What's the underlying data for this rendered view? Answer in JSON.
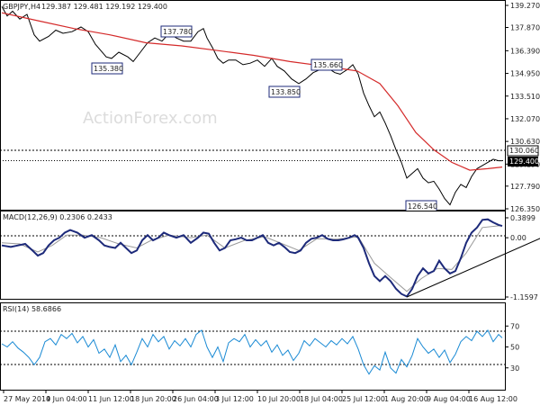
{
  "header": {
    "symbol": "GBPJPY,H4",
    "quote": "129.387 129.481 129.192 129.400"
  },
  "watermark": "ActionForex.com",
  "chart_data": [
    {
      "type": "line",
      "title": "GBPJPY,H4",
      "description": "GBPJPY H4 candlesticks with a moving average",
      "ylim": [
        126.35,
        139.27
      ],
      "yticks": [
        "139.270",
        "137.870",
        "136.390",
        "134.950",
        "133.510",
        "132.070",
        "130.630",
        "129.190",
        "127.790",
        "126.350"
      ],
      "x_labels": [
        "27 May 2019",
        "4 Jun 04:00",
        "11 Jun 12:00",
        "18 Jun 20:00",
        "26 Jun 04:00",
        "3 Jul 12:00",
        "10 Jul 20:00",
        "18 Jul 04:00",
        "25 Jul 12:00",
        "1 Aug 20:00",
        "9 Aug 04:00",
        "16 Aug 12:00"
      ],
      "current_price": "129.400",
      "resistance_level": "130.060",
      "annotations": [
        "137.780",
        "135.380",
        "135.660",
        "133.850",
        "126.540"
      ],
      "price_path": [
        [
          0,
          139.2
        ],
        [
          6,
          138.6
        ],
        [
          12,
          138.9
        ],
        [
          20,
          138.4
        ],
        [
          28,
          138.7
        ],
        [
          36,
          137.4
        ],
        [
          42,
          137.0
        ],
        [
          52,
          137.3
        ],
        [
          60,
          137.7
        ],
        [
          68,
          137.5
        ],
        [
          78,
          137.6
        ],
        [
          88,
          137.9
        ],
        [
          96,
          137.6
        ],
        [
          104,
          136.8
        ],
        [
          110,
          136.4
        ],
        [
          116,
          136.0
        ],
        [
          122,
          135.9
        ],
        [
          130,
          136.3
        ],
        [
          140,
          136.0
        ],
        [
          146,
          135.7
        ],
        [
          154,
          136.3
        ],
        [
          162,
          136.9
        ],
        [
          170,
          137.2
        ],
        [
          178,
          137.0
        ],
        [
          186,
          137.5
        ],
        [
          194,
          137.2
        ],
        [
          202,
          137.0
        ],
        [
          210,
          137.0
        ],
        [
          218,
          137.6
        ],
        [
          224,
          137.8
        ],
        [
          228,
          137.2
        ],
        [
          234,
          136.6
        ],
        [
          240,
          135.9
        ],
        [
          246,
          135.6
        ],
        [
          252,
          135.8
        ],
        [
          260,
          135.8
        ],
        [
          268,
          135.5
        ],
        [
          276,
          135.6
        ],
        [
          284,
          135.8
        ],
        [
          292,
          135.4
        ],
        [
          300,
          135.9
        ],
        [
          306,
          135.4
        ],
        [
          314,
          135.1
        ],
        [
          322,
          134.6
        ],
        [
          330,
          134.3
        ],
        [
          338,
          134.6
        ],
        [
          346,
          135.0
        ],
        [
          354,
          135.2
        ],
        [
          362,
          135.3
        ],
        [
          370,
          135.0
        ],
        [
          376,
          134.9
        ],
        [
          384,
          135.2
        ],
        [
          390,
          135.5
        ],
        [
          396,
          134.9
        ],
        [
          402,
          133.7
        ],
        [
          408,
          132.9
        ],
        [
          414,
          132.2
        ],
        [
          420,
          132.5
        ],
        [
          426,
          131.8
        ],
        [
          432,
          131.0
        ],
        [
          438,
          130.1
        ],
        [
          444,
          129.3
        ],
        [
          450,
          128.3
        ],
        [
          456,
          128.6
        ],
        [
          462,
          128.9
        ],
        [
          468,
          128.3
        ],
        [
          474,
          128.0
        ],
        [
          480,
          128.1
        ],
        [
          486,
          127.6
        ],
        [
          492,
          127.0
        ],
        [
          498,
          126.6
        ],
        [
          504,
          127.4
        ],
        [
          510,
          127.9
        ],
        [
          516,
          127.7
        ],
        [
          522,
          128.4
        ],
        [
          528,
          128.9
        ],
        [
          534,
          129.1
        ],
        [
          540,
          129.3
        ],
        [
          546,
          129.5
        ],
        [
          552,
          129.4
        ],
        [
          556,
          129.4
        ]
      ],
      "ma_path": [
        [
          0,
          138.8
        ],
        [
          40,
          138.3
        ],
        [
          80,
          137.8
        ],
        [
          120,
          137.4
        ],
        [
          160,
          136.9
        ],
        [
          200,
          136.7
        ],
        [
          240,
          136.4
        ],
        [
          280,
          136.1
        ],
        [
          320,
          135.7
        ],
        [
          360,
          135.4
        ],
        [
          395,
          135.1
        ],
        [
          420,
          134.3
        ],
        [
          440,
          132.9
        ],
        [
          460,
          131.2
        ],
        [
          480,
          130.1
        ],
        [
          500,
          129.3
        ],
        [
          520,
          128.8
        ],
        [
          540,
          128.9
        ],
        [
          556,
          129.0
        ]
      ]
    },
    {
      "type": "line",
      "title": "MACD(12,26,9) 0.2306 0.2433",
      "ylim": [
        -1.1597,
        0.3899
      ],
      "yticks": [
        "0.3899",
        "0.00",
        "-1.1597"
      ],
      "macd_path": [
        [
          0,
          -0.15
        ],
        [
          10,
          -0.18
        ],
        [
          18,
          -0.15
        ],
        [
          26,
          -0.12
        ],
        [
          34,
          -0.25
        ],
        [
          40,
          -0.35
        ],
        [
          46,
          -0.3
        ],
        [
          52,
          -0.15
        ],
        [
          58,
          -0.05
        ],
        [
          64,
          0.0
        ],
        [
          70,
          0.1
        ],
        [
          76,
          0.15
        ],
        [
          84,
          0.1
        ],
        [
          92,
          0.0
        ],
        [
          100,
          0.05
        ],
        [
          108,
          -0.05
        ],
        [
          114,
          -0.15
        ],
        [
          120,
          -0.18
        ],
        [
          126,
          -0.2
        ],
        [
          132,
          -0.1
        ],
        [
          138,
          -0.2
        ],
        [
          144,
          -0.3
        ],
        [
          150,
          -0.25
        ],
        [
          156,
          -0.05
        ],
        [
          162,
          0.05
        ],
        [
          168,
          -0.05
        ],
        [
          174,
          0.0
        ],
        [
          180,
          0.1
        ],
        [
          186,
          0.05
        ],
        [
          194,
          0.0
        ],
        [
          202,
          0.05
        ],
        [
          210,
          -0.1
        ],
        [
          218,
          0.0
        ],
        [
          224,
          0.1
        ],
        [
          230,
          0.08
        ],
        [
          236,
          -0.1
        ],
        [
          242,
          -0.25
        ],
        [
          248,
          -0.2
        ],
        [
          254,
          -0.05
        ],
        [
          260,
          -0.03
        ],
        [
          266,
          0.0
        ],
        [
          272,
          -0.05
        ],
        [
          278,
          -0.05
        ],
        [
          284,
          0.0
        ],
        [
          290,
          0.05
        ],
        [
          296,
          -0.1
        ],
        [
          302,
          -0.15
        ],
        [
          308,
          -0.1
        ],
        [
          314,
          -0.18
        ],
        [
          320,
          -0.28
        ],
        [
          326,
          -0.3
        ],
        [
          332,
          -0.25
        ],
        [
          338,
          -0.1
        ],
        [
          344,
          -0.02
        ],
        [
          350,
          0.0
        ],
        [
          356,
          0.05
        ],
        [
          362,
          -0.02
        ],
        [
          368,
          -0.05
        ],
        [
          374,
          -0.05
        ],
        [
          380,
          -0.03
        ],
        [
          386,
          0.0
        ],
        [
          392,
          0.05
        ],
        [
          396,
          0.0
        ],
        [
          402,
          -0.2
        ],
        [
          408,
          -0.5
        ],
        [
          414,
          -0.75
        ],
        [
          420,
          -0.85
        ],
        [
          426,
          -0.75
        ],
        [
          432,
          -0.85
        ],
        [
          438,
          -1.0
        ],
        [
          444,
          -1.1
        ],
        [
          450,
          -1.15
        ],
        [
          456,
          -1.0
        ],
        [
          462,
          -0.75
        ],
        [
          468,
          -0.6
        ],
        [
          474,
          -0.7
        ],
        [
          480,
          -0.65
        ],
        [
          486,
          -0.45
        ],
        [
          492,
          -0.6
        ],
        [
          498,
          -0.7
        ],
        [
          504,
          -0.65
        ],
        [
          510,
          -0.4
        ],
        [
          516,
          -0.1
        ],
        [
          522,
          0.1
        ],
        [
          528,
          0.2
        ],
        [
          534,
          0.35
        ],
        [
          540,
          0.36
        ],
        [
          546,
          0.3
        ],
        [
          552,
          0.25
        ],
        [
          556,
          0.23
        ]
      ],
      "signal_path": [
        [
          0,
          -0.1
        ],
        [
          20,
          -0.12
        ],
        [
          40,
          -0.28
        ],
        [
          56,
          -0.15
        ],
        [
          72,
          0.05
        ],
        [
          90,
          0.05
        ],
        [
          110,
          0.0
        ],
        [
          130,
          -0.12
        ],
        [
          150,
          -0.2
        ],
        [
          166,
          -0.05
        ],
        [
          186,
          0.05
        ],
        [
          210,
          0.0
        ],
        [
          228,
          0.05
        ],
        [
          248,
          -0.2
        ],
        [
          270,
          -0.05
        ],
        [
          292,
          0.02
        ],
        [
          312,
          -0.12
        ],
        [
          330,
          -0.25
        ],
        [
          350,
          -0.02
        ],
        [
          372,
          -0.03
        ],
        [
          396,
          0.02
        ],
        [
          414,
          -0.5
        ],
        [
          432,
          -0.78
        ],
        [
          450,
          -1.05
        ],
        [
          466,
          -0.8
        ],
        [
          484,
          -0.6
        ],
        [
          500,
          -0.62
        ],
        [
          516,
          -0.3
        ],
        [
          534,
          0.2
        ],
        [
          556,
          0.24
        ]
      ],
      "trendline": [
        [
          450,
          -1.16
        ],
        [
          600,
          0.0
        ]
      ]
    },
    {
      "type": "line",
      "title": "RSI(14) 58.6866",
      "ylim": [
        0,
        100
      ],
      "yticks": [
        "70",
        "50",
        "30"
      ],
      "rsi_path": [
        [
          0,
          53
        ],
        [
          6,
          50
        ],
        [
          12,
          55
        ],
        [
          18,
          49
        ],
        [
          24,
          45
        ],
        [
          30,
          40
        ],
        [
          36,
          33
        ],
        [
          42,
          40
        ],
        [
          48,
          55
        ],
        [
          54,
          58
        ],
        [
          60,
          52
        ],
        [
          66,
          62
        ],
        [
          72,
          58
        ],
        [
          78,
          63
        ],
        [
          84,
          54
        ],
        [
          90,
          60
        ],
        [
          96,
          50
        ],
        [
          102,
          57
        ],
        [
          108,
          44
        ],
        [
          114,
          48
        ],
        [
          120,
          40
        ],
        [
          126,
          52
        ],
        [
          132,
          36
        ],
        [
          138,
          42
        ],
        [
          144,
          33
        ],
        [
          150,
          45
        ],
        [
          156,
          58
        ],
        [
          162,
          50
        ],
        [
          168,
          62
        ],
        [
          174,
          55
        ],
        [
          180,
          60
        ],
        [
          186,
          48
        ],
        [
          192,
          56
        ],
        [
          198,
          51
        ],
        [
          204,
          58
        ],
        [
          210,
          50
        ],
        [
          216,
          62
        ],
        [
          222,
          66
        ],
        [
          228,
          50
        ],
        [
          234,
          40
        ],
        [
          240,
          50
        ],
        [
          246,
          36
        ],
        [
          252,
          54
        ],
        [
          258,
          58
        ],
        [
          264,
          55
        ],
        [
          270,
          62
        ],
        [
          276,
          50
        ],
        [
          282,
          57
        ],
        [
          288,
          51
        ],
        [
          294,
          56
        ],
        [
          300,
          45
        ],
        [
          306,
          52
        ],
        [
          312,
          42
        ],
        [
          318,
          47
        ],
        [
          324,
          37
        ],
        [
          330,
          44
        ],
        [
          336,
          56
        ],
        [
          342,
          51
        ],
        [
          348,
          58
        ],
        [
          354,
          54
        ],
        [
          360,
          50
        ],
        [
          366,
          56
        ],
        [
          372,
          52
        ],
        [
          378,
          58
        ],
        [
          384,
          53
        ],
        [
          390,
          60
        ],
        [
          396,
          48
        ],
        [
          402,
          33
        ],
        [
          408,
          24
        ],
        [
          414,
          32
        ],
        [
          420,
          28
        ],
        [
          426,
          45
        ],
        [
          432,
          30
        ],
        [
          438,
          25
        ],
        [
          444,
          38
        ],
        [
          450,
          31
        ],
        [
          456,
          42
        ],
        [
          462,
          58
        ],
        [
          468,
          50
        ],
        [
          474,
          44
        ],
        [
          480,
          48
        ],
        [
          486,
          40
        ],
        [
          492,
          47
        ],
        [
          498,
          35
        ],
        [
          504,
          43
        ],
        [
          510,
          55
        ],
        [
          516,
          60
        ],
        [
          522,
          56
        ],
        [
          528,
          65
        ],
        [
          534,
          60
        ],
        [
          540,
          66
        ],
        [
          546,
          55
        ],
        [
          552,
          62
        ],
        [
          556,
          58.7
        ]
      ]
    }
  ]
}
